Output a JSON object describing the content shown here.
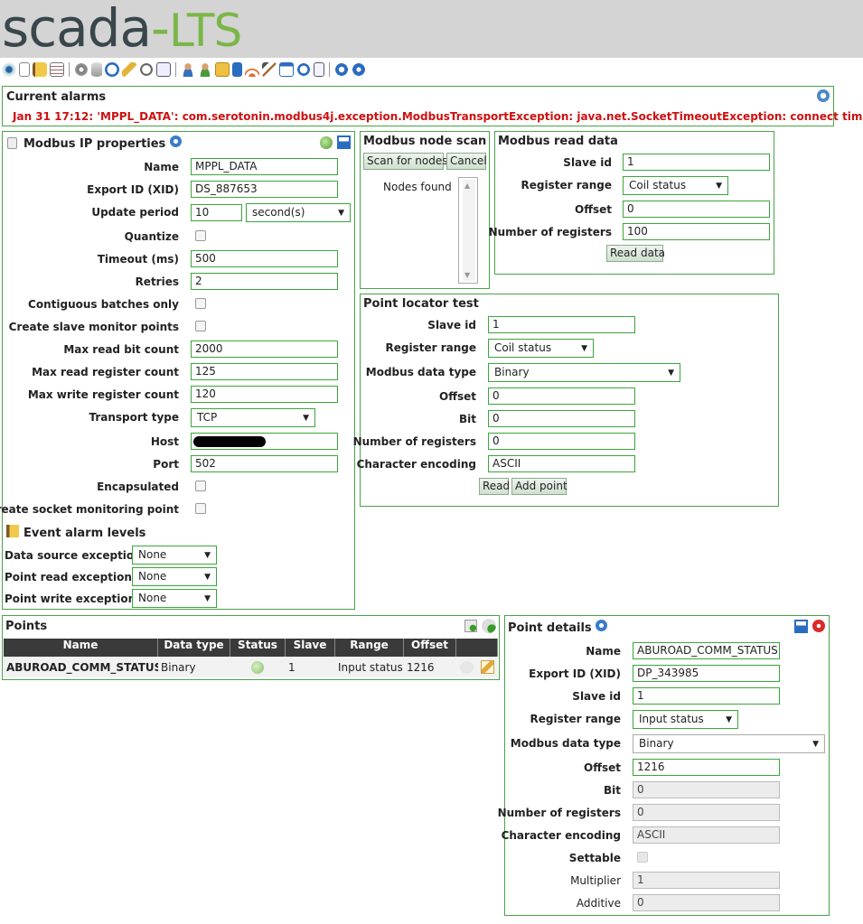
{
  "header": {
    "logo_main": "scada",
    "logo_dash": "-",
    "logo_suffix": "LTS"
  },
  "toolbar": {
    "icons": [
      "eye-icon",
      "page-icon",
      "flag-icon",
      "list-icon",
      "gear-icon",
      "database-icon",
      "clock-icon",
      "wrench-icon",
      "link-icon",
      "report-icon",
      "user-icon",
      "users-icon",
      "folder-icon",
      "calculator-icon",
      "signal-icon",
      "hammer-icon",
      "window-icon",
      "refresh-icon",
      "document-icon",
      "stop-icon",
      "help-icon"
    ]
  },
  "alarms": {
    "title": "Current alarms",
    "message": "Jan 31 17:12: 'MPPL_DATA': com.serotonin.modbus4j.exception.ModbusTransportException: java.net.SocketTimeoutException: connect timed out"
  },
  "ip_props": {
    "title": "Modbus IP properties",
    "fields": {
      "name_label": "Name",
      "name_value": "MPPL_DATA",
      "xid_label": "Export ID (XID)",
      "xid_value": "DS_887653",
      "update_label": "Update period",
      "update_value": "10",
      "update_unit": "second(s)",
      "quantize_label": "Quantize",
      "timeout_label": "Timeout (ms)",
      "timeout_value": "500",
      "retries_label": "Retries",
      "retries_value": "2",
      "contig_label": "Contiguous batches only",
      "slave_mon_label": "Create slave monitor points",
      "max_bit_label": "Max read bit count",
      "max_bit_value": "2000",
      "max_reg_label": "Max read register count",
      "max_reg_value": "125",
      "max_write_label": "Max write register count",
      "max_write_value": "120",
      "transport_label": "Transport type",
      "transport_value": "TCP",
      "host_label": "Host",
      "port_label": "Port",
      "port_value": "502",
      "encap_label": "Encapsulated",
      "socket_label": "Create socket monitoring point"
    },
    "event_title": "Event alarm levels",
    "events": [
      {
        "label": "Data source exception",
        "value": "None"
      },
      {
        "label": "Point read exception",
        "value": "None"
      },
      {
        "label": "Point write exception",
        "value": "None"
      }
    ]
  },
  "node_scan": {
    "title": "Modbus node scan",
    "scan_button": "Scan for nodes",
    "cancel_button": "Cancel",
    "nodes_label": "Nodes found"
  },
  "read_data": {
    "title": "Modbus read data",
    "slave_label": "Slave id",
    "slave_value": "1",
    "range_label": "Register range",
    "range_value": "Coil status",
    "offset_label": "Offset",
    "offset_value": "0",
    "count_label": "Number of registers",
    "count_value": "100",
    "read_button": "Read data"
  },
  "locator": {
    "title": "Point locator test",
    "slave_label": "Slave id",
    "slave_value": "1",
    "range_label": "Register range",
    "range_value": "Coil status",
    "type_label": "Modbus data type",
    "type_value": "Binary",
    "offset_label": "Offset",
    "offset_value": "0",
    "bit_label": "Bit",
    "bit_value": "0",
    "count_label": "Number of registers",
    "count_value": "0",
    "enc_label": "Character encoding",
    "enc_value": "ASCII",
    "read_button": "Read",
    "add_button": "Add point"
  },
  "points": {
    "title": "Points",
    "columns": [
      "Name",
      "Data type",
      "Status",
      "Slave",
      "Range",
      "Offset"
    ],
    "rows": [
      {
        "name": "ABUROAD_COMM_STATUS",
        "type": "Binary",
        "slave": "1",
        "range": "Input status",
        "offset": "1216"
      }
    ]
  },
  "details": {
    "title": "Point details",
    "name_label": "Name",
    "name_value": "ABUROAD_COMM_STATUS",
    "xid_label": "Export ID (XID)",
    "xid_value": "DP_343985",
    "slave_label": "Slave id",
    "slave_value": "1",
    "range_label": "Register range",
    "range_value": "Input status",
    "type_label": "Modbus data type",
    "type_value": "Binary",
    "offset_label": "Offset",
    "offset_value": "1216",
    "bit_label": "Bit",
    "bit_value": "0",
    "count_label": "Number of registers",
    "count_value": "0",
    "enc_label": "Character encoding",
    "enc_value": "ASCII",
    "settable_label": "Settable",
    "mult_label": "Multiplier",
    "mult_value": "1",
    "add_label": "Additive",
    "add_value": "0"
  },
  "colors": {
    "border": "#4aa24a",
    "alarm": "#cc1111",
    "header_bg": "#d4d4d4",
    "logo_dark": "#39474c",
    "logo_green": "#7ab648"
  }
}
